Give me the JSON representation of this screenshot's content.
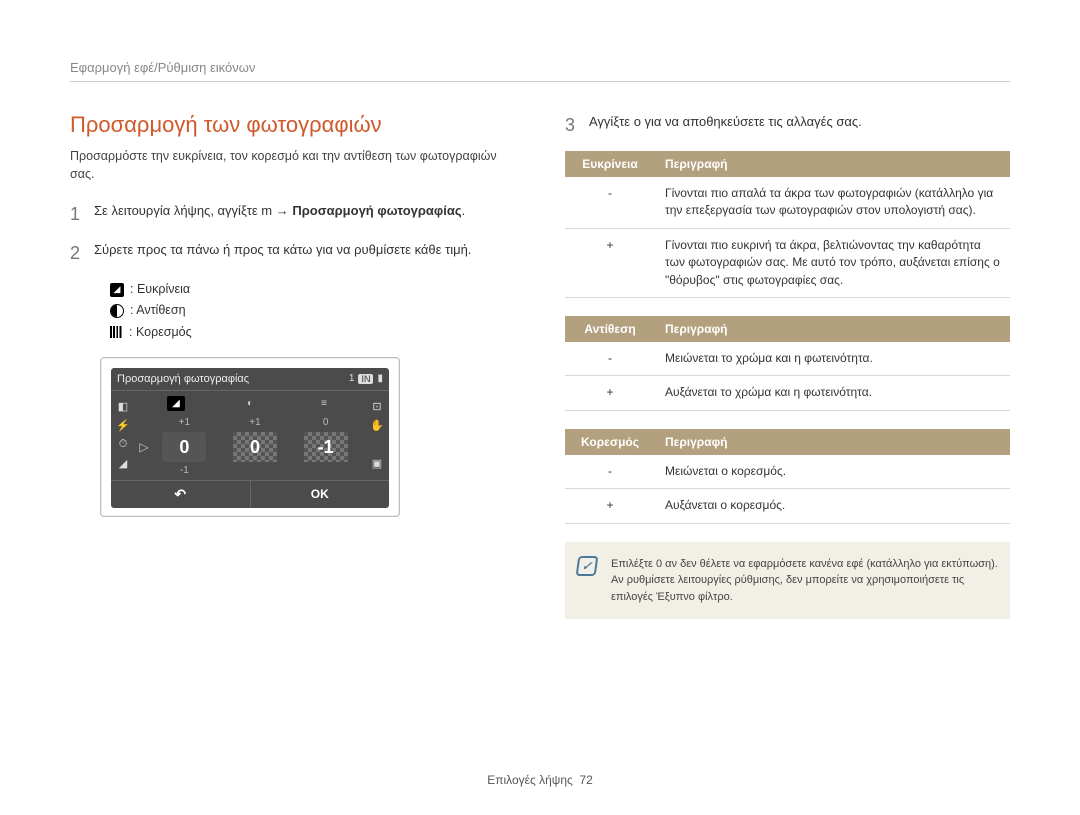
{
  "header": "Εφαρμογή εφέ/Ρύθμιση εικόνων",
  "section_title": "Προσαρμογή των φωτογραφιών",
  "intro": "Προσαρμόστε την ευκρίνεια, τον κορεσμό και την αντίθεση των φωτογραφιών σας.",
  "steps": {
    "s1_pre": "Σε λειτουργία λήψης, αγγίξτε m  → ",
    "s1_bold": "Προσαρμογή φωτογραφίας",
    "s1_post": ".",
    "s2": "Σύρετε προς τα πάνω ή προς τα κάτω για να ρυθμίσετε κάθε τιμή.",
    "s3": "Αγγίξτε o    για να αποθηκεύσετε τις αλλαγές σας."
  },
  "legend": {
    "sharp": ": Ευκρίνεια",
    "contrast": ": Αντίθεση",
    "sat": ": Κορεσμός"
  },
  "panel": {
    "title": "Προσαρμογή φωτογραφίας",
    "count": "1",
    "badge": "IN",
    "p1": "+1",
    "p1b": "+1",
    "p1c": "0",
    "z": "0",
    "zb": "0",
    "zc": "-1",
    "m1": "-1",
    "back": "↶",
    "ok": "OK"
  },
  "table1": {
    "h1": "Ευκρίνεια",
    "h2": "Περιγραφή",
    "r1": "Γίνονται πιο απαλά τα άκρα των φωτογραφιών (κατάλληλο για την επεξεργασία των φωτογραφιών στον υπολογιστή σας).",
    "r2": "Γίνονται πιο ευκρινή τα άκρα, βελτιώνοντας την καθαρότητα των φωτογραφιών σας. Με αυτό τον τρόπο, αυξάνεται επίσης ο \"θόρυβος\" στις φωτογραφίες σας."
  },
  "table2": {
    "h1": "Αντίθεση",
    "h2": "Περιγραφή",
    "r1": "Μειώνεται το χρώμα και η φωτεινότητα.",
    "r2": "Αυξάνεται το χρώμα και η φωτεινότητα."
  },
  "table3": {
    "h1": "Κορεσμός",
    "h2": "Περιγραφή",
    "r1": "Μειώνεται ο κορεσμός.",
    "r2": "Αυξάνεται ο κορεσμός."
  },
  "minus": "-",
  "plus": "+",
  "note1": "Επιλέξτε 0 αν δεν θέλετε να εφαρμόσετε κανένα εφέ (κατάλληλο για εκτύπωση).",
  "note2": "Αν ρυθμίσετε λειτουργίες ρύθμισης, δεν μπορείτε να χρησιμοποιήσετε τις επιλογές Έξυπνο φίλτρο.",
  "footer_label": "Επιλογές λήψης",
  "footer_page": "72"
}
